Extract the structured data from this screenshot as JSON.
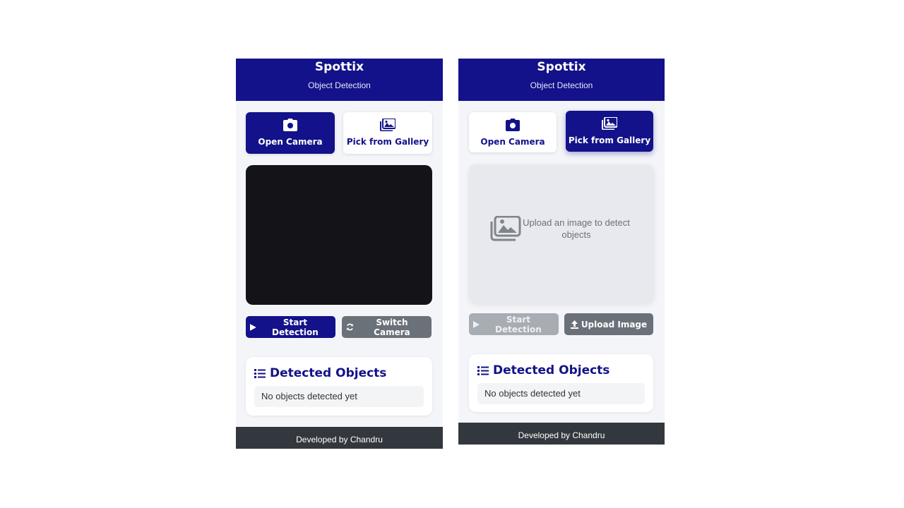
{
  "left": {
    "header": {
      "title": "Spottix",
      "subtitle": "Object Detection"
    },
    "tabs": [
      {
        "label": "Open Camera",
        "icon": "camera-icon",
        "active": true
      },
      {
        "label": "Pick from Gallery",
        "icon": "images-icon",
        "active": false
      }
    ],
    "actions": {
      "start_label": "Start Detection",
      "secondary_label": "Switch Camera"
    },
    "detected": {
      "title": "Detected Objects",
      "empty_text": "No objects detected yet"
    },
    "footer": "Developed by Chandru"
  },
  "right": {
    "header": {
      "title": "Spottix",
      "subtitle": "Object Detection"
    },
    "tabs": [
      {
        "label": "Open Camera",
        "icon": "camera-icon",
        "active": false
      },
      {
        "label": "Pick from Gallery",
        "icon": "images-icon",
        "active": true
      }
    ],
    "upload_placeholder": "Upload an image to detect objects",
    "actions": {
      "start_label": "Start Detection",
      "secondary_label": "Upload Image"
    },
    "detected": {
      "title": "Detected Objects",
      "empty_text": "No objects detected yet"
    },
    "footer": "Developed by Chandru"
  },
  "colors": {
    "brand": "#13128a",
    "footer": "#33383e",
    "grey_button": "#6b7178",
    "disabled_button": "#a8adb4"
  }
}
